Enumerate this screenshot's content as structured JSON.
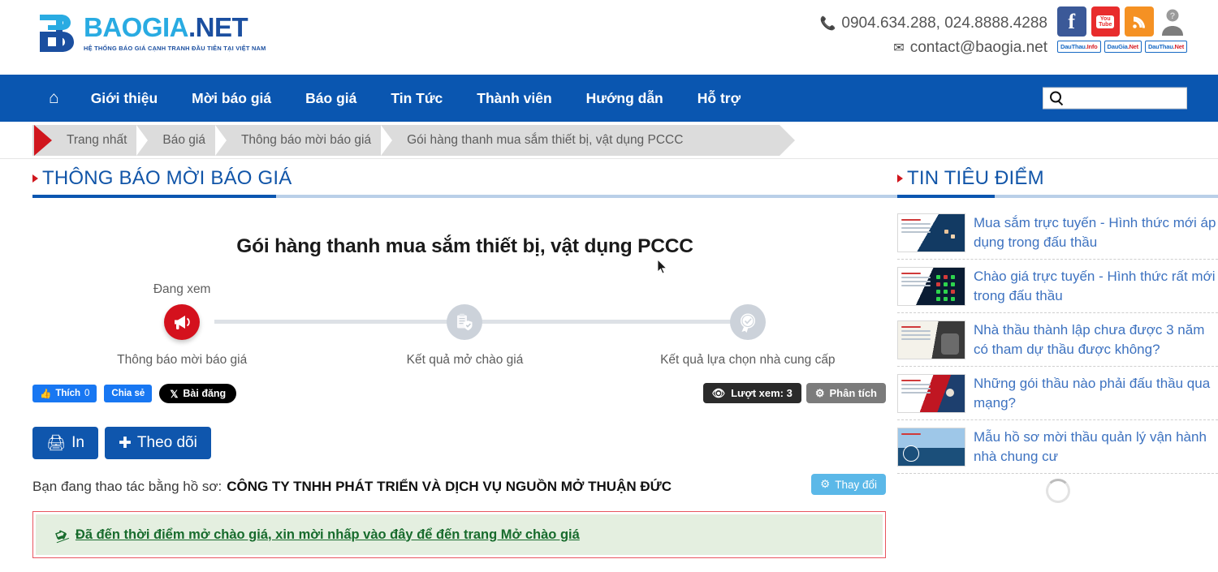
{
  "header": {
    "logo": {
      "brand_part1": "BAOGIA",
      "brand_part2": ".NET",
      "tagline": "HỆ THỐNG BÁO GIÁ CẠNH TRANH ĐẦU TIÊN TẠI VIỆT NAM"
    },
    "phone": "0904.634.288, 024.8888.4288",
    "email": "contact@baogia.net",
    "social": [
      "facebook-icon",
      "youtube-icon",
      "rss-icon",
      "user-icon"
    ],
    "mini_badges": [
      {
        "a": "DauThau",
        "b": ".Info"
      },
      {
        "a": "DauGia",
        "b": ".Net"
      },
      {
        "a": "DauThau",
        "b": ".Net"
      }
    ]
  },
  "nav": {
    "home_icon": "home-icon",
    "items": [
      "Giới thiệu",
      "Mời báo giá",
      "Báo giá",
      "Tin Tức",
      "Thành viên",
      "Hướng dẫn",
      "Hỗ trợ"
    ],
    "search_placeholder": ""
  },
  "breadcrumb": [
    "Trang nhất",
    "Báo giá",
    "Thông báo mời báo giá",
    "Gói hàng thanh mua sắm thiết bị, vật dụng PCCC"
  ],
  "main": {
    "section_title": "THÔNG BÁO MỜI BÁO GIÁ",
    "package_title": "Gói hàng thanh mua sắm thiết bị, vật dụng PCCC",
    "stepper": {
      "current_label": "Đang xem",
      "steps": [
        {
          "label": "Thông báo mời báo giá",
          "icon": "megaphone-icon",
          "state": "active"
        },
        {
          "label": "Kết quả mở chào giá",
          "icon": "clipboard-shield-icon",
          "state": "idle"
        },
        {
          "label": "Kết quả lựa chọn nhà cung cấp",
          "icon": "award-check-icon",
          "state": "idle"
        }
      ]
    },
    "social_buttons": {
      "like_label": "Thích",
      "like_count": "0",
      "share_label": "Chia sẻ",
      "x_label": "Bài đăng"
    },
    "stats": {
      "views_label": "Lượt xem: 3",
      "analyze_label": "Phân tích"
    },
    "actions": {
      "print_label": "In",
      "follow_label": "Theo dõi"
    },
    "profile": {
      "lead": "Bạn đang thao tác bằng hồ sơ:",
      "name": "CÔNG TY TNHH PHÁT TRIỂN VÀ DỊCH VỤ NGUỒN MỞ THUẬN ĐỨC",
      "change_label": "Thay đổi"
    },
    "alert": {
      "text": "Đã đến thời điểm mở chào giá, xin mời nhấp vào đây để đến trang Mở chào giá"
    }
  },
  "sidebar": {
    "section_title": "TIN TIÊU ĐIỂM",
    "news": [
      {
        "title": "Mua sắm trực tuyến - Hình thức mới áp dụng trong đấu thầu",
        "thumb": "th-a"
      },
      {
        "title": "Chào giá trực tuyến - Hình thức rất mới trong đấu thầu",
        "thumb": "th-b"
      },
      {
        "title": "Nhà thầu thành lập chưa được 3 năm có tham dự thầu được không?",
        "thumb": "th-c"
      },
      {
        "title": "Những gói thầu nào phải đấu thầu qua mạng?",
        "thumb": "th-d"
      },
      {
        "title": "Mẫu hồ sơ mời thầu quản lý vận hành nhà chung cư",
        "thumb": "th-e"
      }
    ]
  },
  "colors": {
    "brand_blue": "#0a56b0",
    "brand_cyan": "#29ABE2",
    "accent_red": "#d0161d",
    "alert_green_text": "#176b2c",
    "alert_bg": "#e4efe0",
    "alert_border": "#e8555f"
  }
}
